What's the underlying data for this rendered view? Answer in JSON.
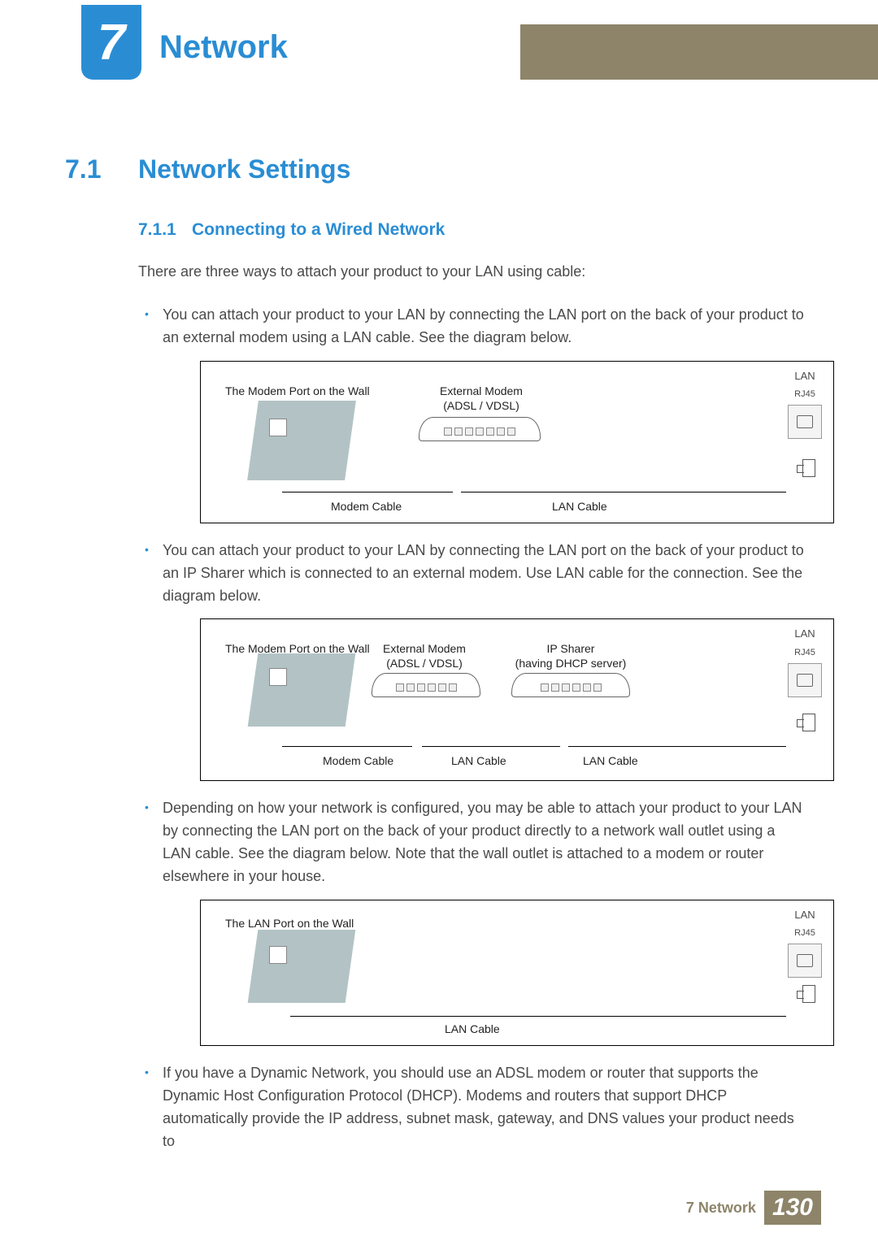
{
  "chapter": {
    "number": "7",
    "title": "Network"
  },
  "section": {
    "number": "7.1",
    "title": "Network Settings"
  },
  "subsection": {
    "number": "7.1.1",
    "title": "Connecting to a Wired Network"
  },
  "intro": "There are three ways to attach your product to your LAN using cable:",
  "bullets": [
    "You can attach your product to your LAN by connecting the LAN port on the back of your product to an external modem using a LAN cable. See the diagram below.",
    "You can attach your product to your LAN by connecting the LAN port on the back of your product to an IP Sharer which is connected to an external modem. Use LAN cable for the connection. See the diagram below.",
    "Depending on how your network is configured, you may be able to attach your product to your LAN by connecting the LAN port on the back of your product directly to a network wall outlet using a LAN cable. See the diagram below. Note that the wall outlet is attached to a modem or router elsewhere in your house.",
    "If you have a Dynamic Network, you should use an ADSL modem or router that supports the Dynamic Host Configuration Protocol (DHCP). Modems and routers that support DHCP automatically provide the IP address, subnet mask, gateway, and DNS values your product needs to"
  ],
  "diagram_labels": {
    "wall_modem": "The Modem Port on the Wall",
    "wall_lan": "The LAN Port on the Wall",
    "external_modem": "External Modem",
    "adsl": "(ADSL / VDSL)",
    "ip_sharer": "IP Sharer",
    "dhcp": "(having DHCP server)",
    "lan": "LAN",
    "rj45": "RJ45",
    "modem_cable": "Modem Cable",
    "lan_cable": "LAN Cable"
  },
  "footer": {
    "chapter_ref": "7 Network",
    "page": "130"
  }
}
